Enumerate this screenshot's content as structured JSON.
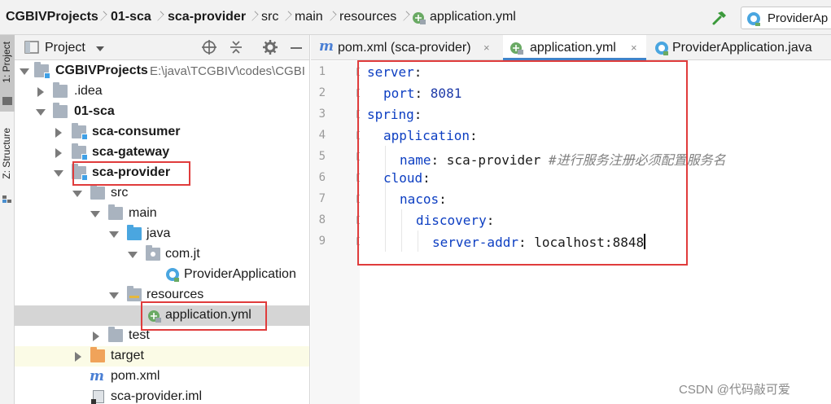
{
  "breadcrumb": {
    "items": [
      {
        "label": "CGBIVProjects",
        "bold": true
      },
      {
        "label": "01-sca",
        "bold": true
      },
      {
        "label": "sca-provider",
        "bold": true
      },
      {
        "label": "src",
        "bold": false
      },
      {
        "label": "main",
        "bold": false
      },
      {
        "label": "resources",
        "bold": false
      },
      {
        "label": "application.yml",
        "bold": false
      }
    ],
    "run_config": "ProviderAp"
  },
  "tool_strip": {
    "project_tab": "1: Project",
    "structure_tab": "Z: Structure"
  },
  "project_panel": {
    "title": "Project",
    "tree": [
      {
        "label": "CGBIVProjects",
        "path": "E:\\java\\TCGBIV\\codes\\CGBI",
        "bold": true,
        "icon": "module-folder-icon"
      },
      {
        "label": ".idea",
        "icon": "folder-icon"
      },
      {
        "label": "01-sca",
        "bold": true,
        "icon": "folder-icon"
      },
      {
        "label": "sca-consumer",
        "bold": true,
        "icon": "module-folder-icon"
      },
      {
        "label": "sca-gateway",
        "bold": true,
        "icon": "module-folder-icon"
      },
      {
        "label": "sca-provider",
        "bold": true,
        "icon": "module-folder-icon"
      },
      {
        "label": "src",
        "icon": "folder-icon"
      },
      {
        "label": "main",
        "icon": "folder-icon"
      },
      {
        "label": "java",
        "icon": "source-folder-icon"
      },
      {
        "label": "com.jt",
        "icon": "package-icon"
      },
      {
        "label": "ProviderApplication",
        "icon": "spring-class-icon"
      },
      {
        "label": "resources",
        "icon": "resources-folder-icon"
      },
      {
        "label": "application.yml",
        "icon": "yaml-file-icon",
        "selected": true
      },
      {
        "label": "test",
        "icon": "folder-icon"
      },
      {
        "label": "target",
        "icon": "excluded-folder-icon"
      },
      {
        "label": "pom.xml",
        "icon": "maven-icon"
      },
      {
        "label": "sca-provider.iml",
        "icon": "iml-file-icon"
      }
    ]
  },
  "editor": {
    "tabs": [
      {
        "label": "pom.xml (sca-provider)",
        "icon": "maven-icon",
        "close": "×"
      },
      {
        "label": "application.yml",
        "icon": "yaml-file-icon",
        "close": "×",
        "active": true
      },
      {
        "label": "ProviderApplication.java",
        "icon": "spring-class-icon",
        "close": "×"
      }
    ],
    "line_numbers": [
      "1",
      "2",
      "3",
      "4",
      "5",
      "6",
      "7",
      "8",
      "9"
    ],
    "lines": [
      {
        "key": "server",
        "sep": ":",
        "value": "",
        "comment": ""
      },
      {
        "key": "port",
        "sep": ": ",
        "value": "8081",
        "comment": ""
      },
      {
        "key": "spring",
        "sep": ":",
        "value": "",
        "comment": ""
      },
      {
        "key": "application",
        "sep": ":",
        "value": "",
        "comment": ""
      },
      {
        "key": "name",
        "sep": ": ",
        "value": "sca-provider",
        "comment": "#进行服务注册必须配置服务名"
      },
      {
        "key": "cloud",
        "sep": ":",
        "value": "",
        "comment": ""
      },
      {
        "key": "nacos",
        "sep": ":",
        "value": "",
        "comment": ""
      },
      {
        "key": "discovery",
        "sep": ":",
        "value": "",
        "comment": ""
      },
      {
        "key": "server-addr",
        "sep": ": ",
        "value": "localhost:8848",
        "comment": ""
      }
    ]
  },
  "watermark": "CSDN @代码敲可爱",
  "colors": {
    "yaml_key": "#0c3ec2",
    "number": "#1f3ba8",
    "comment": "#808080",
    "highlight_box": "#e03c3c",
    "selection": "#d5d5d5"
  }
}
